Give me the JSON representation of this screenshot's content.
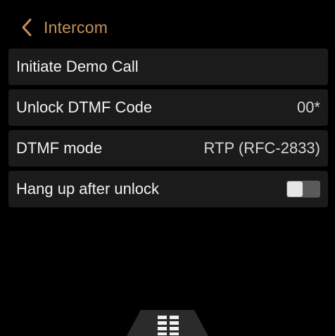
{
  "header": {
    "back_icon": "chevron-left-icon",
    "title": "Intercom",
    "accent_color": "#c8905a"
  },
  "settings": {
    "demo_call": {
      "label": "Initiate Demo Call"
    },
    "dtmf_code": {
      "label": "Unlock DTMF Code",
      "value": "00*"
    },
    "dtmf_mode": {
      "label": "DTMF mode",
      "value": "RTP (RFC-2833)"
    },
    "hang_up": {
      "label": "Hang up after unlock",
      "enabled": false
    }
  },
  "bottom_bar": {
    "icon": "grid-menu-icon"
  }
}
